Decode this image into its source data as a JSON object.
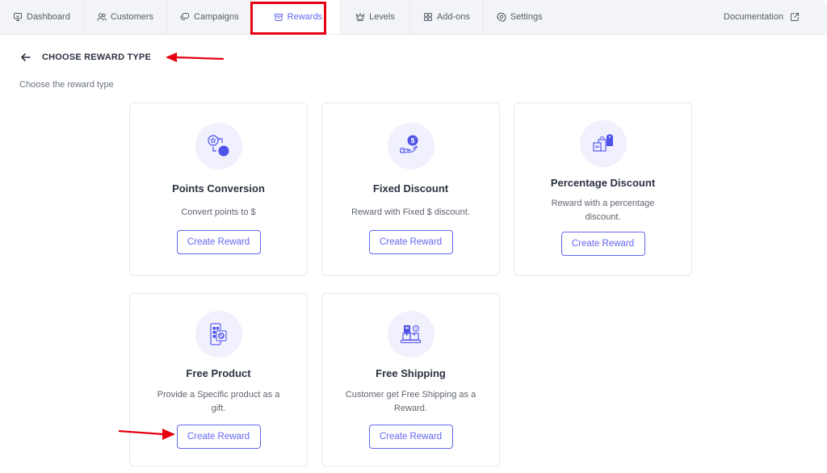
{
  "nav": {
    "items": [
      {
        "label": "Dashboard",
        "icon": "monitor-icon",
        "active": false
      },
      {
        "label": "Customers",
        "icon": "users-icon",
        "active": false
      },
      {
        "label": "Campaigns",
        "icon": "chat-bubbles-icon",
        "active": false
      },
      {
        "label": "Rewards",
        "icon": "gift-box-icon",
        "active": true
      },
      {
        "label": "Levels",
        "icon": "crown-icon",
        "active": false
      },
      {
        "label": "Add-ons",
        "icon": "grid-icon",
        "active": false
      },
      {
        "label": "Settings",
        "icon": "gear-icon",
        "active": false
      }
    ],
    "documentation": {
      "label": "Documentation",
      "icon": "external-link-icon"
    }
  },
  "page": {
    "title": "CHOOSE REWARD TYPE",
    "subtitle": "Choose the reward type"
  },
  "colors": {
    "accent": "#6366f1",
    "annotation": "#e60012"
  },
  "cards": [
    {
      "title": "Points Conversion",
      "description": "Convert points to $",
      "button": "Create Reward",
      "icon": "points-conversion-icon"
    },
    {
      "title": "Fixed Discount",
      "description": "Reward with Fixed $ discount.",
      "button": "Create Reward",
      "icon": "hand-coin-icon"
    },
    {
      "title": "Percentage Discount",
      "description": "Reward with a percentage discount.",
      "button": "Create Reward",
      "icon": "shopping-bag-tag-icon"
    },
    {
      "title": "Free Product",
      "description": "Provide a Specific product as a gift.",
      "button": "Create Reward",
      "icon": "product-gift-icon"
    },
    {
      "title": "Free Shipping",
      "description": "Customer get Free Shipping as a Reward.",
      "button": "Create Reward",
      "icon": "shipping-boxes-icon"
    }
  ]
}
